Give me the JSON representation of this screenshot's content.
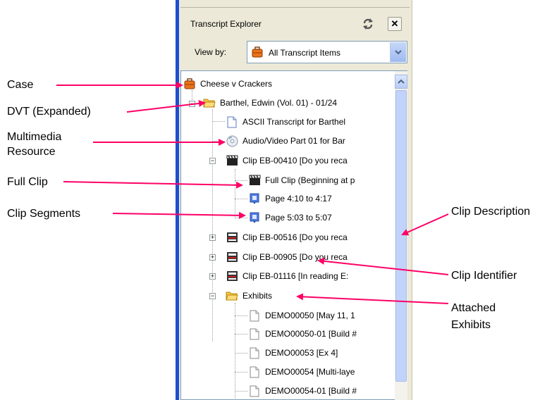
{
  "panel": {
    "title": "Transcript Explorer",
    "close_label": "✕",
    "viewby_label": "View by:",
    "viewby_value": "All Transcript Items"
  },
  "tree": {
    "case": "Cheese v Crackers",
    "dvt": "Barthel, Edwin (Vol. 01) - 01/24",
    "ascii": "ASCII Transcript for Barthel",
    "audio": "Audio/Video Part 01 for Bar",
    "clip1": "Clip EB-00410 [Do you reca",
    "full_clip": "Full Clip (Beginning at p",
    "page1": "Page 4:10 to 4:17",
    "page2": "Page 5:03 to 5:07",
    "clip2": "Clip EB-00516 [Do you reca",
    "clip3": "Clip EB-00905 [Do you reca",
    "clip4": "Clip EB-01116 [In reading E:",
    "exhibits": "Exhibits",
    "ex1": "DEMO00050 [May 11, 1",
    "ex2": "DEMO00050-01 [Build #",
    "ex3": "DEMO00053 [Ex 4]",
    "ex4": "DEMO00054 [Multi-laye",
    "ex5": "DEMO00054-01 [Build #"
  },
  "callouts": {
    "case": "Case",
    "dvt": "DVT (Expanded)",
    "multimedia_1": "Multimedia",
    "multimedia_2": "Resource",
    "full_clip": "Full Clip",
    "clip_segments": "Clip Segments",
    "clip_description": "Clip Description",
    "clip_identifier": "Clip Identifier",
    "attached_1": "Attached",
    "attached_2": "Exhibits"
  },
  "colors": {
    "arrow": "#ff0066",
    "accent_bar": "#1c4fd0",
    "panel_bg": "#ece9d8"
  }
}
